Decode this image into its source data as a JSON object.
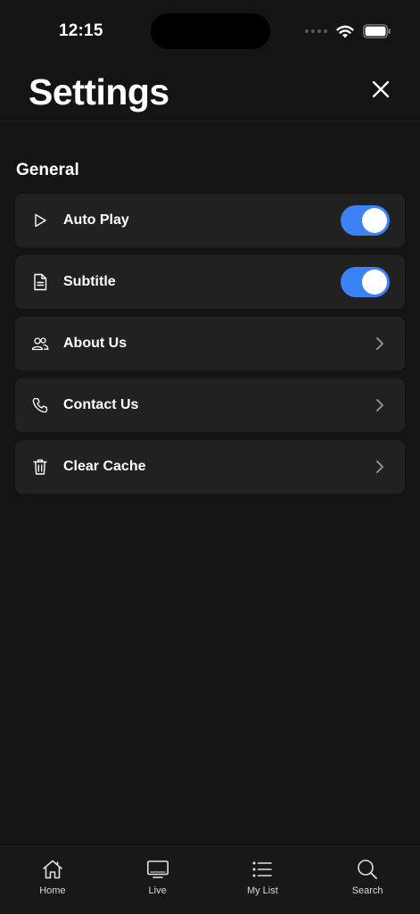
{
  "status_bar": {
    "time": "12:15",
    "icons": [
      "signal-dots-icon",
      "wifi-icon",
      "battery-icon"
    ]
  },
  "header": {
    "title": "Settings",
    "close_icon": "close-icon"
  },
  "sections": [
    {
      "title": "General",
      "items": [
        {
          "label": "Auto Play",
          "icon": "play-icon",
          "control": "toggle",
          "value": true
        },
        {
          "label": "Subtitle",
          "icon": "document-icon",
          "control": "toggle",
          "value": true
        },
        {
          "label": "About Us",
          "icon": "users-icon",
          "control": "chevron"
        },
        {
          "label": "Contact Us",
          "icon": "phone-icon",
          "control": "chevron"
        },
        {
          "label": "Clear Cache",
          "icon": "trash-icon",
          "control": "chevron"
        }
      ]
    }
  ],
  "tab_bar": {
    "tabs": [
      {
        "label": "Home",
        "icon": "home-icon"
      },
      {
        "label": "Live",
        "icon": "tv-icon"
      },
      {
        "label": "My List",
        "icon": "list-icon"
      },
      {
        "label": "Search",
        "icon": "search-icon"
      }
    ]
  },
  "colors": {
    "background": "#141414",
    "row_background": "#212121",
    "toggle_on": "#3b82f6",
    "text": "#ffffff"
  }
}
